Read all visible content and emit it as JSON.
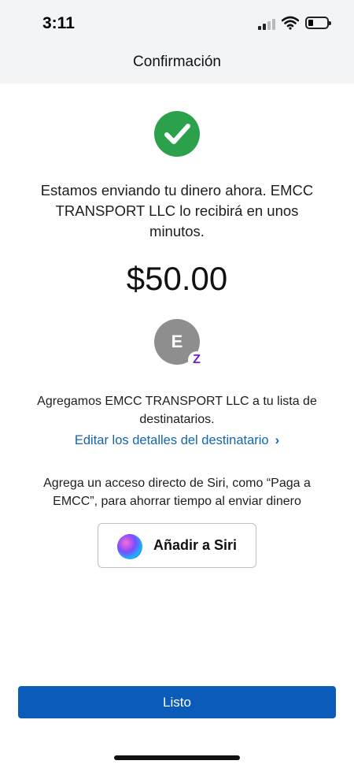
{
  "status_bar": {
    "time": "3:11"
  },
  "header": {
    "title": "Confirmación"
  },
  "confirmation": {
    "icon": "check-circle-icon",
    "message": "Estamos enviando tu dinero ahora. EMCC TRANSPORT LLC lo recibirá en unos minutos.",
    "amount": "$50.00"
  },
  "recipient": {
    "avatar_initial": "E",
    "badge": "Z",
    "added_text": "Agregamos EMCC TRANSPORT LLC a tu lista de destinatarios.",
    "edit_link": "Editar los detalles del destinatario",
    "edit_chevron": "›"
  },
  "siri": {
    "text": "Agrega un acceso directo de Siri, como “Paga a EMCC”, para ahorrar tiempo al enviar dinero",
    "button_label": "Añadir a Siri"
  },
  "footer": {
    "done_label": "Listo"
  },
  "colors": {
    "success": "#2aa14a",
    "link": "#1565a8",
    "primary_button": "#0b5cb8",
    "zelle": "#6d1ed4"
  }
}
